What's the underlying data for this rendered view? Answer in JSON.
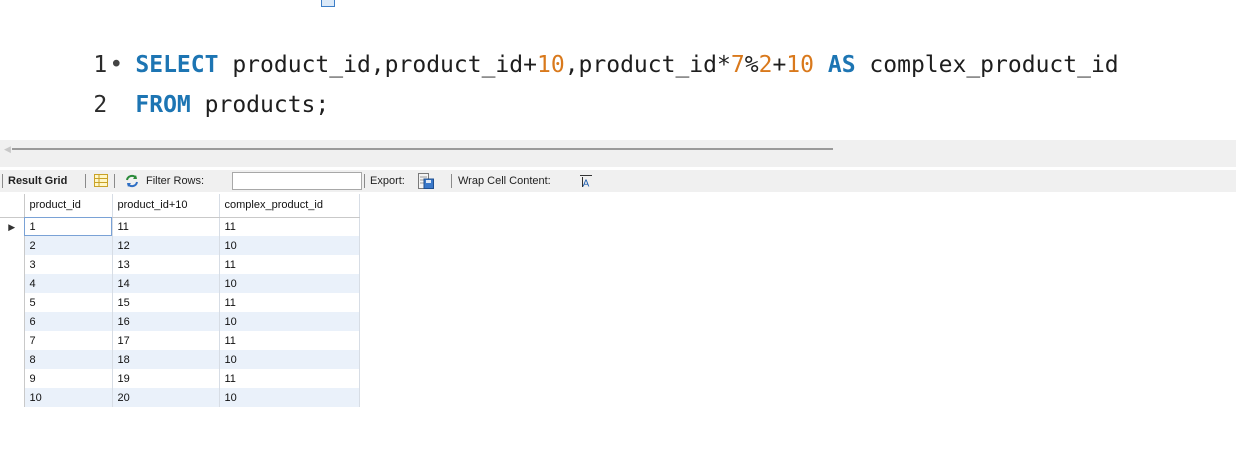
{
  "editor": {
    "lines": [
      {
        "number": "1",
        "marker": "•",
        "tokens": [
          {
            "text": "SELECT",
            "kind": "kw"
          },
          {
            "text": " product_id,product_id+",
            "kind": "plain"
          },
          {
            "text": "10",
            "kind": "num"
          },
          {
            "text": ",product_id*",
            "kind": "plain"
          },
          {
            "text": "7",
            "kind": "num"
          },
          {
            "text": "%",
            "kind": "plain"
          },
          {
            "text": "2",
            "kind": "num"
          },
          {
            "text": "+",
            "kind": "plain"
          },
          {
            "text": "10",
            "kind": "num"
          },
          {
            "text": " ",
            "kind": "plain"
          },
          {
            "text": "AS",
            "kind": "kw"
          },
          {
            "text": " complex_product_id",
            "kind": "plain"
          }
        ]
      },
      {
        "number": "2",
        "marker": "",
        "tokens": [
          {
            "text": "FROM",
            "kind": "kw"
          },
          {
            "text": " products;",
            "kind": "plain"
          }
        ]
      }
    ]
  },
  "toolbar": {
    "result_grid_label": "Result Grid",
    "filter_rows_label": "Filter Rows:",
    "filter_value": "",
    "export_label": "Export:",
    "wrap_label": "Wrap Cell Content:"
  },
  "grid": {
    "columns": [
      "product_id",
      "product_id+10",
      "complex_product_id"
    ],
    "rows": [
      [
        "1",
        "11",
        "11"
      ],
      [
        "2",
        "12",
        "10"
      ],
      [
        "3",
        "13",
        "11"
      ],
      [
        "4",
        "14",
        "10"
      ],
      [
        "5",
        "15",
        "11"
      ],
      [
        "6",
        "16",
        "10"
      ],
      [
        "7",
        "17",
        "11"
      ],
      [
        "8",
        "18",
        "10"
      ],
      [
        "9",
        "19",
        "11"
      ],
      [
        "10",
        "20",
        "10"
      ]
    ],
    "current_row_marker": "▶"
  },
  "colors": {
    "keyword": "#1d75b3",
    "number": "#d9791c",
    "alt_row": "#eaf1fa"
  }
}
